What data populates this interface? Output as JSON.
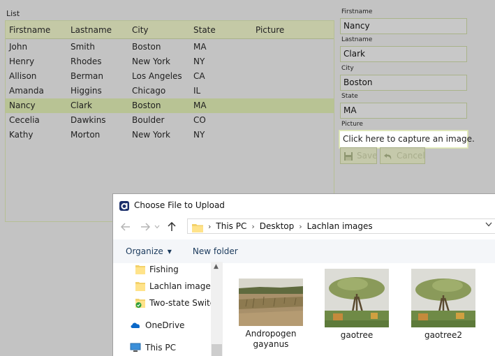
{
  "list": {
    "title": "List",
    "columns": [
      "Firstname",
      "Lastname",
      "City",
      "State",
      "Picture"
    ],
    "rows": [
      [
        "John",
        "Smith",
        "Boston",
        "MA",
        ""
      ],
      [
        "Henry",
        "Rhodes",
        "New York",
        "NY",
        ""
      ],
      [
        "Allison",
        "Berman",
        "Los Angeles",
        "CA",
        ""
      ],
      [
        "Amanda",
        "Higgins",
        "Chicago",
        "IL",
        ""
      ],
      [
        "Nancy",
        "Clark",
        "Boston",
        "MA",
        ""
      ],
      [
        "Cecelia",
        "Dawkins",
        "Boulder",
        "CO",
        ""
      ],
      [
        "Kathy",
        "Morton",
        "New York",
        "NY",
        ""
      ]
    ],
    "selected_row": 4
  },
  "form": {
    "firstname_label": "Firstname",
    "firstname_value": "Nancy",
    "lastname_label": "Lastname",
    "lastname_value": "Clark",
    "city_label": "City",
    "city_value": "Boston",
    "state_label": "State",
    "state_value": "MA",
    "picture_label": "Picture",
    "picture_prompt": "Click here to capture an image.",
    "save_label": "Save",
    "cancel_label": "Cancel"
  },
  "dialog": {
    "title": "Choose File to Upload",
    "breadcrumb": [
      "This PC",
      "Desktop",
      "Lachlan images"
    ],
    "toolbar": {
      "organize_label": "Organize",
      "new_folder_label": "New folder"
    },
    "nav_items": [
      {
        "label": "Fishing",
        "icon": "folder-icon"
      },
      {
        "label": "Lachlan images",
        "icon": "folder-icon"
      },
      {
        "label": "Two-state Switch",
        "icon": "folder-synced-icon"
      },
      {
        "label": "OneDrive",
        "icon": "cloud-icon"
      },
      {
        "label": "This PC",
        "icon": "computer-icon"
      }
    ],
    "files": [
      {
        "name": "Andropogen gayanus"
      },
      {
        "name": "gaotree"
      },
      {
        "name": "gaotree2"
      }
    ]
  },
  "colors": {
    "accent": "#b8c394",
    "panel_border": "#b6bf95",
    "background": "#c3c3c3"
  }
}
